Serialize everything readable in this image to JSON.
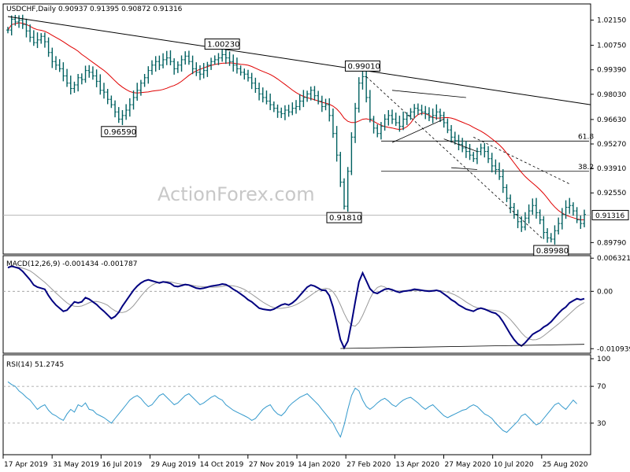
{
  "chart_data": [
    {
      "type": "candlestick",
      "title": "USDCHF,Daily  0.90937 0.91395 0.90872 0.91316",
      "watermark": "ActionForex.com",
      "ylim": [
        0.8915,
        1.0305
      ],
      "yticks": [
        "1.02150",
        "1.00750",
        "0.99390",
        "0.98030",
        "0.96630",
        "0.95270",
        "0.93910",
        "0.92550",
        "0.91316",
        "0.89790"
      ],
      "ytick_values": [
        1.0215,
        1.0075,
        0.9939,
        0.9803,
        0.9663,
        0.9527,
        0.9391,
        0.9255,
        0.91316,
        0.8979
      ],
      "current_price": "0.91316",
      "current_value": 0.91316,
      "fib_levels": [
        {
          "label": "61.8",
          "value": 0.9543
        },
        {
          "label": "38.2",
          "value": 0.9375
        }
      ],
      "annotations": [
        {
          "label": "1.00230",
          "value": 1.0023
        },
        {
          "label": "0.99010",
          "value": 0.9901
        },
        {
          "label": "0.96590",
          "value": 0.9659
        },
        {
          "label": "0.91810",
          "value": 0.9181
        },
        {
          "label": "0.89980",
          "value": 0.8998
        }
      ],
      "ma_line_color": "#e00000",
      "candle_color": "#006060",
      "trendline_color": "#000000"
    },
    {
      "type": "line",
      "title": "MACD(12,26,9) -0.001434 -0.001787",
      "ylim": [
        -0.0118,
        0.0068
      ],
      "yticks": [
        "0.006321",
        "0.00",
        "-0.010939"
      ],
      "ytick_values": [
        0.006321,
        0.0,
        -0.010939
      ],
      "series": [
        {
          "name": "MACD",
          "color": "#000080"
        },
        {
          "name": "Signal",
          "color": "#999999"
        }
      ]
    },
    {
      "type": "line",
      "title": "RSI(14) 51.2745",
      "ylim": [
        0,
        100
      ],
      "yticks": [
        "100",
        "70",
        "30",
        "0"
      ],
      "ytick_values": [
        100,
        70,
        30,
        0
      ],
      "series": [
        {
          "name": "RSI(14)",
          "color": "#3399cc"
        }
      ]
    }
  ],
  "x_axis": {
    "labels": [
      "17 Apr 2019",
      "31 May 2019",
      "16 Jul 2019",
      "29 Aug 2019",
      "14 Oct 2019",
      "27 Nov 2019",
      "14 Jan 2020",
      "27 Feb 2020",
      "13 Apr 2020",
      "27 May 2020",
      "10 Jul 2020",
      "25 Aug 2020"
    ]
  },
  "price_series": [
    1.016,
    1.022,
    1.0205,
    1.0215,
    1.019,
    1.0155,
    1.012,
    1.009,
    1.0105,
    1.0125,
    1.0095,
    1.0035,
    0.9985,
    0.9965,
    0.9945,
    0.9905,
    0.9865,
    0.9835,
    0.9855,
    0.9895,
    0.9885,
    0.9935,
    0.9925,
    0.9905,
    0.9875,
    0.9825,
    0.9815,
    0.9775,
    0.9745,
    0.9705,
    0.9665,
    0.9685,
    0.9715,
    0.9745,
    0.9785,
    0.9825,
    0.9865,
    0.9895,
    0.9935,
    0.9965,
    0.9985,
    0.9965,
    0.9995,
    1.0005,
    0.9985,
    0.9945,
    0.9965,
    0.9995,
    1.0015,
    0.9985,
    0.9945,
    0.9925,
    0.9915,
    0.9935,
    0.9965,
    0.9985,
    0.9995,
    1.0005,
    1.0023,
    1.0005,
    0.9985,
    0.9965,
    0.9945,
    0.9925,
    0.9915,
    0.9895,
    0.9865,
    0.9835,
    0.9805,
    0.9785,
    0.9765,
    0.9745,
    0.9725,
    0.9705,
    0.9695,
    0.9715,
    0.9705,
    0.9725,
    0.9735,
    0.9765,
    0.9785,
    0.9805,
    0.9825,
    0.9795,
    0.9765,
    0.9735,
    0.9745,
    0.9685,
    0.9585,
    0.9465,
    0.9315,
    0.9181,
    0.9375,
    0.9565,
    0.9725,
    0.9865,
    0.9901,
    0.9785,
    0.9665,
    0.9615,
    0.9585,
    0.9625,
    0.9665,
    0.9685,
    0.9665,
    0.9645,
    0.9625,
    0.9665,
    0.9685,
    0.9705,
    0.9725,
    0.9715,
    0.9705,
    0.9695,
    0.9675,
    0.9685,
    0.9705,
    0.9685,
    0.9645,
    0.9605,
    0.9565,
    0.9545,
    0.9525,
    0.9505,
    0.9485,
    0.9465,
    0.9445,
    0.9485,
    0.9505,
    0.9485,
    0.9445,
    0.9405,
    0.9385,
    0.9345,
    0.9285,
    0.9225,
    0.9175,
    0.9135,
    0.9095,
    0.9065,
    0.9115,
    0.9155,
    0.9185,
    0.9145,
    0.9105,
    0.9035,
    0.9005,
    0.8998,
    0.9045,
    0.9085,
    0.9135,
    0.9175,
    0.9185,
    0.9155,
    0.9105,
    0.9085,
    0.9135
  ],
  "rsi_series": [
    75,
    72,
    70,
    65,
    62,
    58,
    55,
    50,
    45,
    48,
    50,
    44,
    40,
    38,
    35,
    33,
    40,
    45,
    42,
    50,
    48,
    52,
    45,
    44,
    40,
    38,
    36,
    33,
    30,
    35,
    40,
    45,
    50,
    55,
    58,
    60,
    57,
    52,
    48,
    50,
    55,
    60,
    62,
    58,
    54,
    50,
    52,
    56,
    60,
    62,
    58,
    54,
    50,
    52,
    55,
    58,
    60,
    57,
    55,
    50,
    47,
    44,
    42,
    40,
    38,
    36,
    33,
    35,
    40,
    45,
    48,
    50,
    44,
    40,
    38,
    42,
    48,
    52,
    55,
    58,
    60,
    62,
    58,
    54,
    50,
    45,
    40,
    35,
    30,
    22,
    15,
    28,
    45,
    60,
    68,
    65,
    55,
    48,
    45,
    48,
    52,
    55,
    57,
    54,
    50,
    48,
    52,
    55,
    57,
    58,
    55,
    52,
    48,
    45,
    48,
    50,
    46,
    42,
    38,
    36,
    38,
    40,
    42,
    44,
    45,
    48,
    50,
    48,
    44,
    40,
    38,
    35,
    30,
    26,
    22,
    20,
    24,
    28,
    32,
    38,
    40,
    36,
    32,
    28,
    30,
    35,
    40,
    45,
    50,
    52,
    48,
    45,
    50,
    55,
    51
  ],
  "macd_series": [
    0.0045,
    0.0048,
    0.0046,
    0.0044,
    0.0038,
    0.003,
    0.0022,
    0.0012,
    0.0008,
    0.0006,
    0.0004,
    -0.0008,
    -0.0018,
    -0.0026,
    -0.0032,
    -0.0038,
    -0.0036,
    -0.0028,
    -0.002,
    -0.0022,
    -0.002,
    -0.0012,
    -0.0015,
    -0.002,
    -0.0025,
    -0.0032,
    -0.0038,
    -0.0045,
    -0.0052,
    -0.0048,
    -0.004,
    -0.0028,
    -0.0018,
    -0.0008,
    0.0002,
    0.001,
    0.0016,
    0.002,
    0.0022,
    0.002,
    0.0018,
    0.0016,
    0.0018,
    0.0017,
    0.0015,
    0.001,
    0.0009,
    0.0011,
    0.0013,
    0.0012,
    0.0009,
    0.0006,
    0.0005,
    0.0006,
    0.0008,
    0.001,
    0.0011,
    0.0012,
    0.0014,
    0.0013,
    0.0009,
    0.0004,
    0.0,
    -0.0005,
    -0.001,
    -0.0016,
    -0.002,
    -0.0026,
    -0.0032,
    -0.0034,
    -0.0035,
    -0.0036,
    -0.0034,
    -0.003,
    -0.0026,
    -0.0024,
    -0.0026,
    -0.0022,
    -0.0016,
    -0.0008,
    0.0,
    0.0008,
    0.0012,
    0.001,
    0.0006,
    0.0002,
    0.0002,
    -0.0008,
    -0.003,
    -0.006,
    -0.0092,
    -0.0108,
    -0.0095,
    -0.006,
    -0.002,
    0.0018,
    0.0035,
    0.002,
    0.0005,
    -0.0002,
    -0.0004,
    0.0,
    0.0004,
    0.0005,
    0.0003,
    0.0,
    -0.0002,
    0.0,
    0.0001,
    0.0002,
    0.0004,
    0.0003,
    0.0002,
    0.0001,
    0.0,
    0.0001,
    0.0002,
    0.0,
    -0.0005,
    -0.001,
    -0.0016,
    -0.002,
    -0.0026,
    -0.003,
    -0.0034,
    -0.0036,
    -0.0038,
    -0.0034,
    -0.0032,
    -0.0034,
    -0.0037,
    -0.004,
    -0.0042,
    -0.0048,
    -0.0058,
    -0.007,
    -0.0082,
    -0.0092,
    -0.01,
    -0.0104,
    -0.0098,
    -0.009,
    -0.0082,
    -0.0078,
    -0.0074,
    -0.0068,
    -0.0064,
    -0.0058,
    -0.005,
    -0.0042,
    -0.0035,
    -0.003,
    -0.0022,
    -0.0018,
    -0.0014,
    -0.0016,
    -0.0014
  ]
}
